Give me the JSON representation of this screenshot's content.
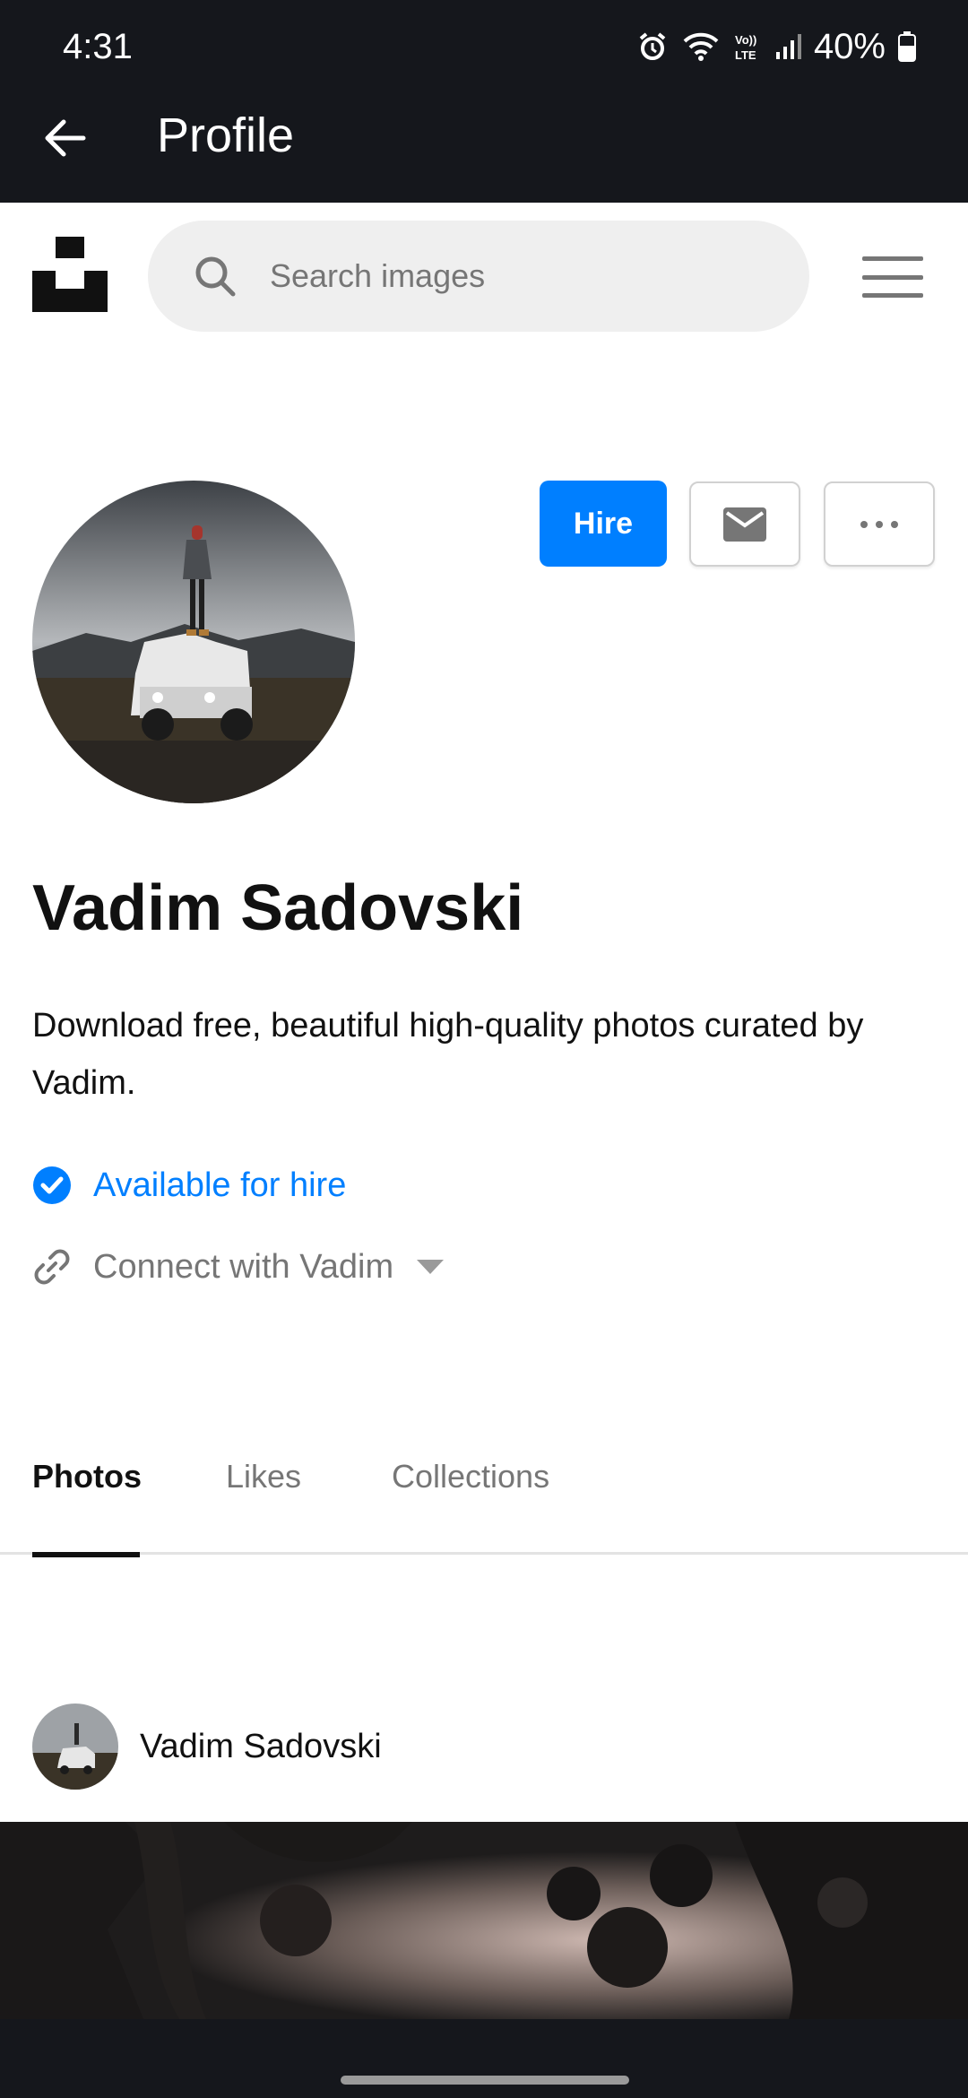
{
  "status_bar": {
    "time": "4:31",
    "battery": "40%",
    "icons": [
      "alarm-icon",
      "wifi-icon",
      "volte-icon",
      "signal-icon",
      "battery-icon"
    ]
  },
  "app_bar": {
    "title": "Profile",
    "back_icon": "arrow-left-icon"
  },
  "header": {
    "search_placeholder": "Search images",
    "logo": "unsplash-logo",
    "menu_icon": "hamburger-menu-icon"
  },
  "profile": {
    "name": "Vadim Sadovski",
    "bio": "Download free, beautiful high-quality photos curated by Vadim.",
    "actions": {
      "hire_label": "Hire",
      "message_icon": "mail-icon",
      "more_icon": "more-horizontal-icon"
    },
    "hire_status": "Available for hire",
    "connect_label": "Connect with Vadim"
  },
  "tabs": [
    {
      "label": "Photos",
      "active": true
    },
    {
      "label": "Likes",
      "active": false
    },
    {
      "label": "Collections",
      "active": false
    }
  ],
  "feed": {
    "author_name": "Vadim Sadovski"
  },
  "colors": {
    "accent": "#007fff",
    "system_bar": "#15171c",
    "muted": "#767676"
  }
}
